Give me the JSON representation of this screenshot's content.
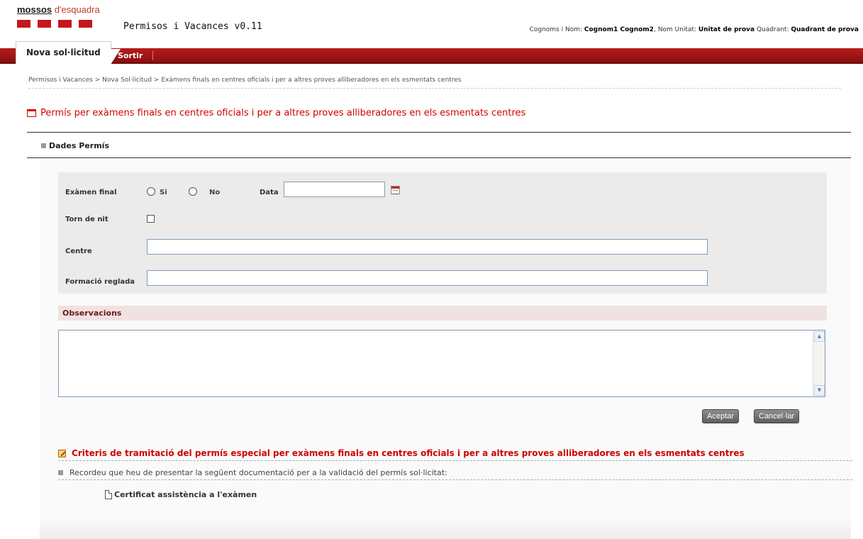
{
  "header": {
    "logo_bold": "mossos",
    "logo_light": "d'esquadra",
    "app_title": "Permisos i Vacances v0.11",
    "user_info": {
      "name_label": "Cognoms i Nom:",
      "name_value": "Cognom1 Cognom2",
      "unit_label": "Nom Unitat:",
      "unit_value": "Unitat de prova",
      "quadrant_label": "Quadrant:",
      "quadrant_value": "Quadrant de prova"
    }
  },
  "tabs": {
    "active": "Nova sol·licitud",
    "exit": "Sortir"
  },
  "breadcrumb": "Permisos i Vacances  >  Nova Sol·licitud  > Exàmens finals en centres oficials i per a altres proves alliberadores en els esmentats centres",
  "page_title": "Permís per exàmens finals en centres oficials i per a altres proves alliberadores en els esmentats centres",
  "section_title": "Dades Permís",
  "form": {
    "final_exam_label": "Exàmen final",
    "yes_label": "Si",
    "no_label": "No",
    "date_label": "Data",
    "date_value": "",
    "night_shift_label": "Torn de nit",
    "centre_label": "Centre",
    "centre_value": "",
    "training_label": "Formació reglada",
    "training_value": ""
  },
  "observations": {
    "title": "Observacions",
    "value": ""
  },
  "buttons": {
    "accept": "Aceptar",
    "cancel": "Cancel·lar"
  },
  "criteria": {
    "title": "Criteris de tramitació del permís especial per exàmens finals en centres oficials i per a altres proves alliberadores en els esmentats centres",
    "reminder": "Recordeu que heu de presentar la següent documentació per a la validació del permís sol·licitat:",
    "documents": [
      "Certificat assistència a l'exàmen"
    ]
  },
  "colors": {
    "brand_red": "#c4161c",
    "title_red": "#d00000",
    "tabbar_red": "#a61616"
  }
}
